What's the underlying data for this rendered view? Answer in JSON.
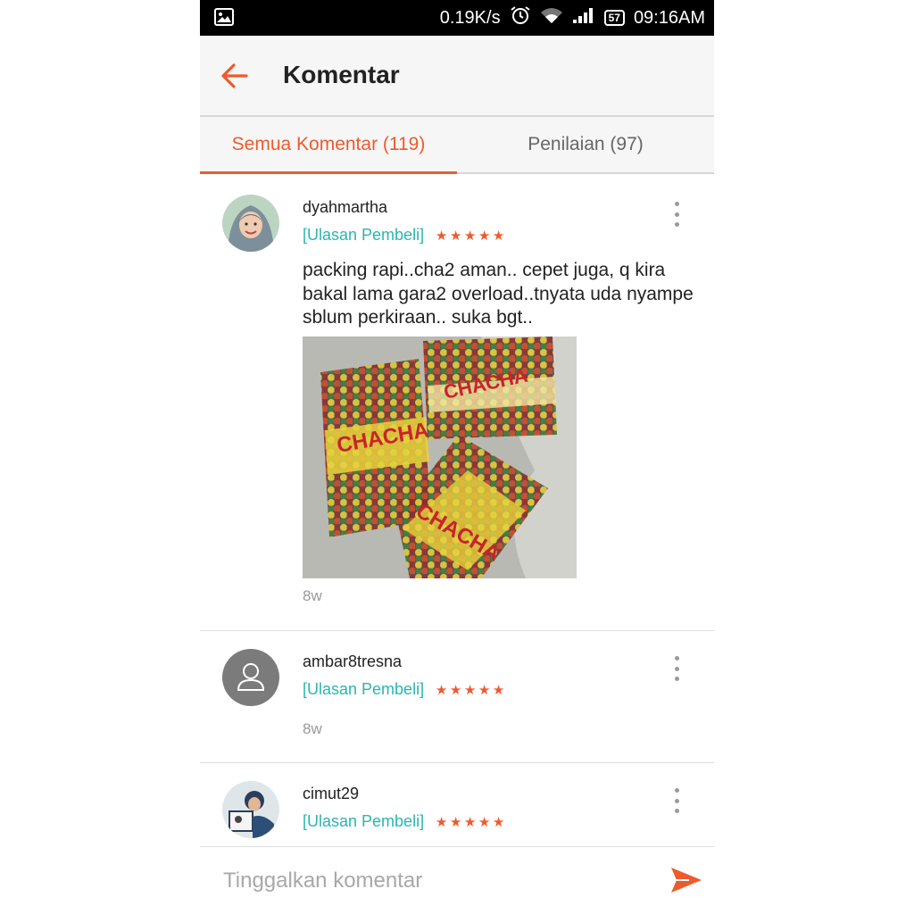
{
  "status_bar": {
    "speed": "0.19K/s",
    "battery": "57",
    "time": "09:16AM"
  },
  "header": {
    "title": "Komentar"
  },
  "tabs": [
    {
      "label": "Semua Komentar (119)",
      "active": true
    },
    {
      "label": "Penilaian (97)",
      "active": false
    }
  ],
  "comments": [
    {
      "username": "dyahmartha",
      "tag": "[Ulasan Pembeli]",
      "rating": 5,
      "text": "packing rapi..cha2 aman.. cepet juga, q kira bakal lama gara2 overload..tnyata uda nyampe sblum perkiraan.. suka bgt..",
      "time": "8w"
    },
    {
      "username": "ambar8tresna",
      "tag": "[Ulasan Pembeli]",
      "rating": 5,
      "time": "8w"
    },
    {
      "username": "cimut29",
      "tag": "[Ulasan Pembeli]",
      "rating": 5
    }
  ],
  "footer": {
    "placeholder": "Tinggalkan komentar"
  },
  "colors": {
    "accent": "#ee5a2e",
    "tag": "#2bb5b0",
    "status_bar": "#000000"
  }
}
